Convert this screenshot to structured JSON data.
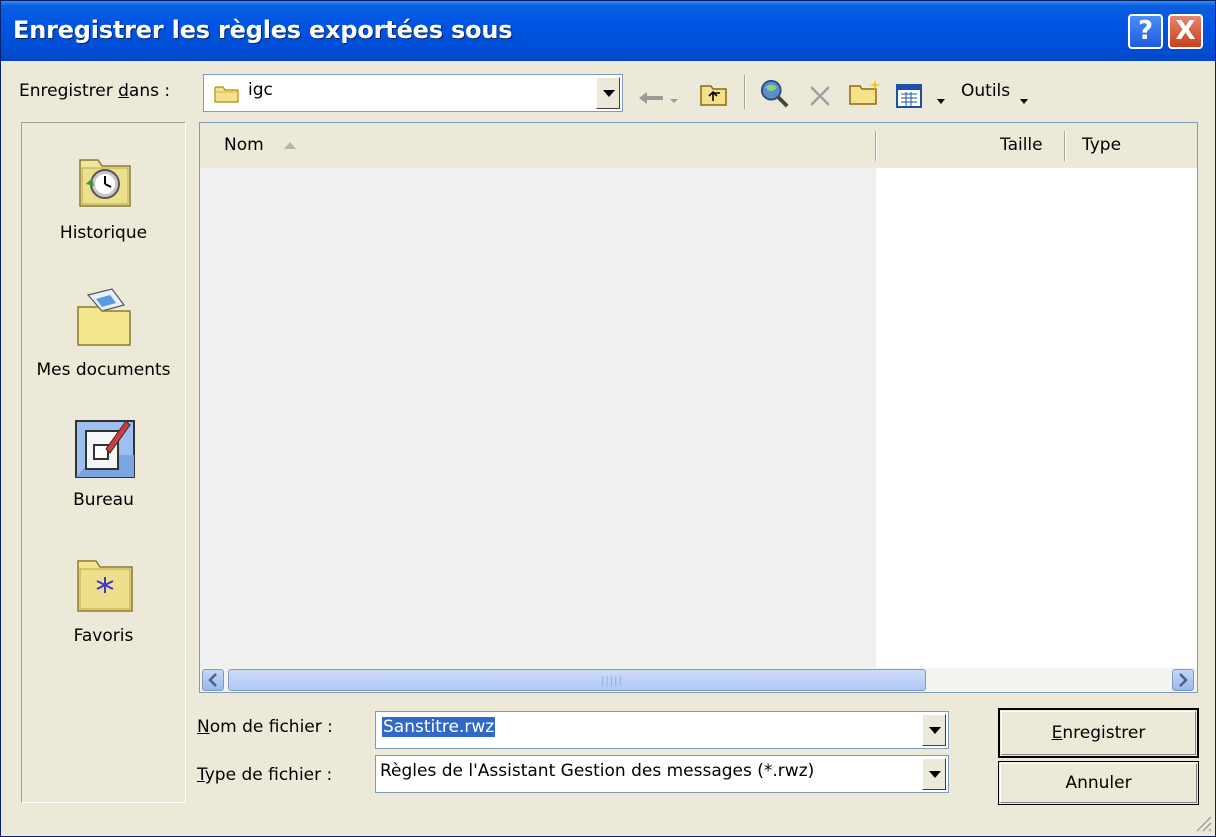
{
  "window": {
    "title": "Enregistrer les règles exportées sous",
    "help_label": "?",
    "close_label": "X"
  },
  "location": {
    "label_pre": "Enregistrer ",
    "label_ul": "d",
    "label_post": "ans :",
    "current_folder": "igc"
  },
  "toolbar": {
    "tools_label": "Outils"
  },
  "places": [
    {
      "label": "Historique",
      "icon": "history-icon"
    },
    {
      "label": "Mes documents",
      "icon": "my-documents-icon"
    },
    {
      "label": "Bureau",
      "icon": "desktop-icon"
    },
    {
      "label": "Favoris",
      "icon": "favorites-icon"
    }
  ],
  "filelist": {
    "columns": [
      "Nom",
      "Taille",
      "Type"
    ]
  },
  "filename": {
    "label_ul": "N",
    "label_rest": "om de fichier :",
    "value": "Sanstitre.rwz"
  },
  "filetype": {
    "label_ul": "T",
    "label_rest": "ype de fichier :",
    "value": "Règles de l'Assistant Gestion des messages (*.rwz)"
  },
  "buttons": {
    "save_ul": "E",
    "save_rest": "nregistrer",
    "cancel": "Annuler"
  }
}
